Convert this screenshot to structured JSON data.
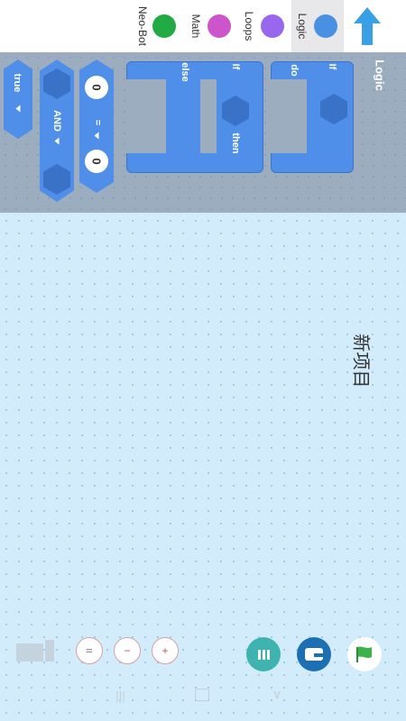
{
  "categories": [
    {
      "label": "Logic",
      "color": "#4a90e2"
    },
    {
      "label": "Loops",
      "color": "#9966ee"
    },
    {
      "label": "Math",
      "color": "#cc55cc"
    },
    {
      "label": "Neo-Bot",
      "color": "#22aa44"
    }
  ],
  "flyout": {
    "title": "Logic",
    "if_do": {
      "if_label": "If",
      "do_label": "do"
    },
    "if_then_else": {
      "if_label": "If",
      "then_label": "then",
      "else_label": "else"
    },
    "compare": {
      "left": "0",
      "op": "=",
      "right": "0"
    },
    "and_block": {
      "op": "AND"
    },
    "bool_block": {
      "value": "true"
    }
  },
  "project": {
    "name": "新项目"
  },
  "toolbar": {
    "pause_glyph": "II",
    "zoom_out_glyph": "−",
    "zoom_in_glyph": "+"
  },
  "colors": {
    "accent": "#4a90e2",
    "topbar": "#ffffff",
    "flyout": "#9dadc0",
    "canvas": "#d3ecfb"
  }
}
